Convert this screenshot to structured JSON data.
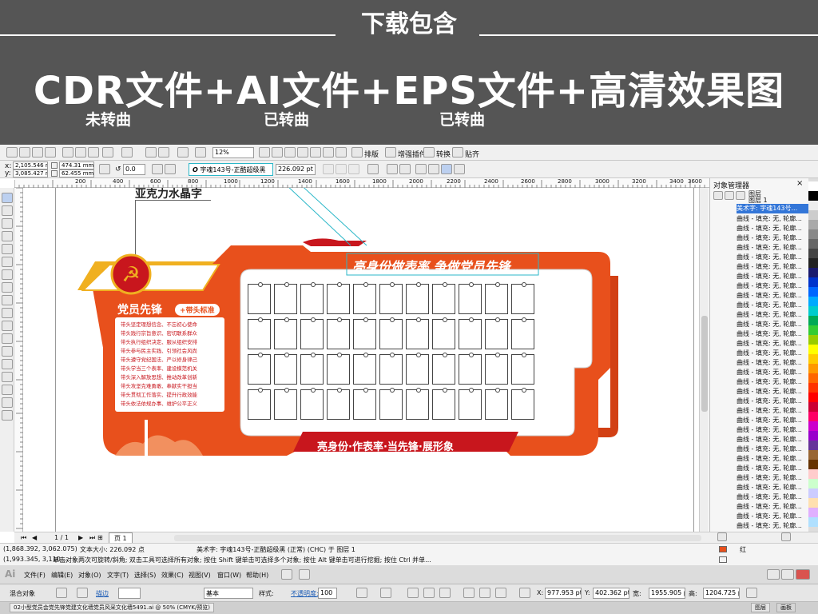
{
  "banner": {
    "subtitle": "下载包含",
    "headline": "CDR文件+AI文件+EPS文件+高清效果图",
    "note1": "未转曲",
    "note2": "已转曲",
    "note3": "已转曲"
  },
  "toolbar": {
    "zoom": "12%",
    "layout_label": "排版",
    "plugin_label": "增强插件",
    "convert_label": "转换",
    "paste_label": "贴齐"
  },
  "property_bar": {
    "x": "2,105.546 mm",
    "y": "3,085.427 mm",
    "width": "474.31 mm",
    "height": "62.455 mm",
    "angle": "0.0",
    "font": "字魂143号-正酷超级黑",
    "font_size": "226.092 pt"
  },
  "ruler_ticks": [
    "200",
    "400",
    "600",
    "800",
    "1000",
    "1200",
    "1400",
    "1600",
    "1800",
    "2000",
    "2200",
    "2400",
    "2600",
    "2800",
    "3000",
    "3200",
    "3400",
    "3600"
  ],
  "design": {
    "overlay_caption": "亚克力水晶字",
    "title": "亮身份做表率 争做党员先锋",
    "left_heading": "党员先锋",
    "tag": "+带头标准",
    "lines": [
      "带头坚定理想信念、不忘初心使命",
      "带头践行宗旨意识、密切联系群众",
      "带头执行组织决定、服从组织安排",
      "带头参与民主实践、引领社会风尚",
      "带头遵守党纪国法、严以修身律己",
      "带头学当三个表率、建设模范机关",
      "带头深入解放思想、推动改革创新",
      "带头攻坚克难勇敢、奉献实干担当",
      "带头贯彻工作落实、提升行政效能",
      "带头依法依规办事、维护公平正义"
    ],
    "slogan": "亮身份·作表率·当先锋·展形象"
  },
  "object_manager": {
    "title": "对象管理器",
    "layer": "图层",
    "sublayer": "图层 1",
    "selected": "美术字: 字魂143号...",
    "curve_item": "曲线 - 填充: 无, 轮廓...",
    "curve_count": 34
  },
  "page_nav": {
    "position": "1 / 1",
    "page_tab": "页 1"
  },
  "status": {
    "coords": "(1,868.392, 3,062.075)",
    "size": "文本大小: 226.092 点",
    "info": "美术字: 字魂143号-正酷超级黑 (正常) (CHC) 于 图层 1",
    "fill": "红",
    "coords2": "(1,993.345, 3,110....",
    "hint": "单击对象两次可旋转/斜角; 双击工具可选择所有对象; 按住 Shift 键单击可选择多个对象; 按住 Alt 键单击可进行挖掘; 按住 Ctrl 并单..."
  },
  "ai": {
    "logo": "Ai",
    "menus": [
      "文件(F)",
      "编辑(E)",
      "对象(O)",
      "文字(T)",
      "选择(S)",
      "效果(C)",
      "视图(V)",
      "窗口(W)",
      "帮助(H)"
    ],
    "mixed": "混合对象",
    "stroke": "描边",
    "basic": "基本",
    "style": "样式:",
    "opacity": "不透明度:",
    "opacity_val": "100",
    "x_val": "977.953 pt",
    "y_val": "402.362 pt",
    "w_val": "1955.905 p",
    "h_val": "1204.725 p",
    "doc_tab": "02小型党员会党先锋党建文化墙党员风采文化墙5491.ai @ 50% (CMYK/预览)",
    "panel1": "图层",
    "panel2": "画板"
  },
  "colors": {
    "orange": "#e8501c",
    "orange_dark": "#d24014",
    "red": "#c8161d",
    "gold": "#f0b020",
    "cyan": "#2bb7c8",
    "banner_bg": "#555555"
  }
}
